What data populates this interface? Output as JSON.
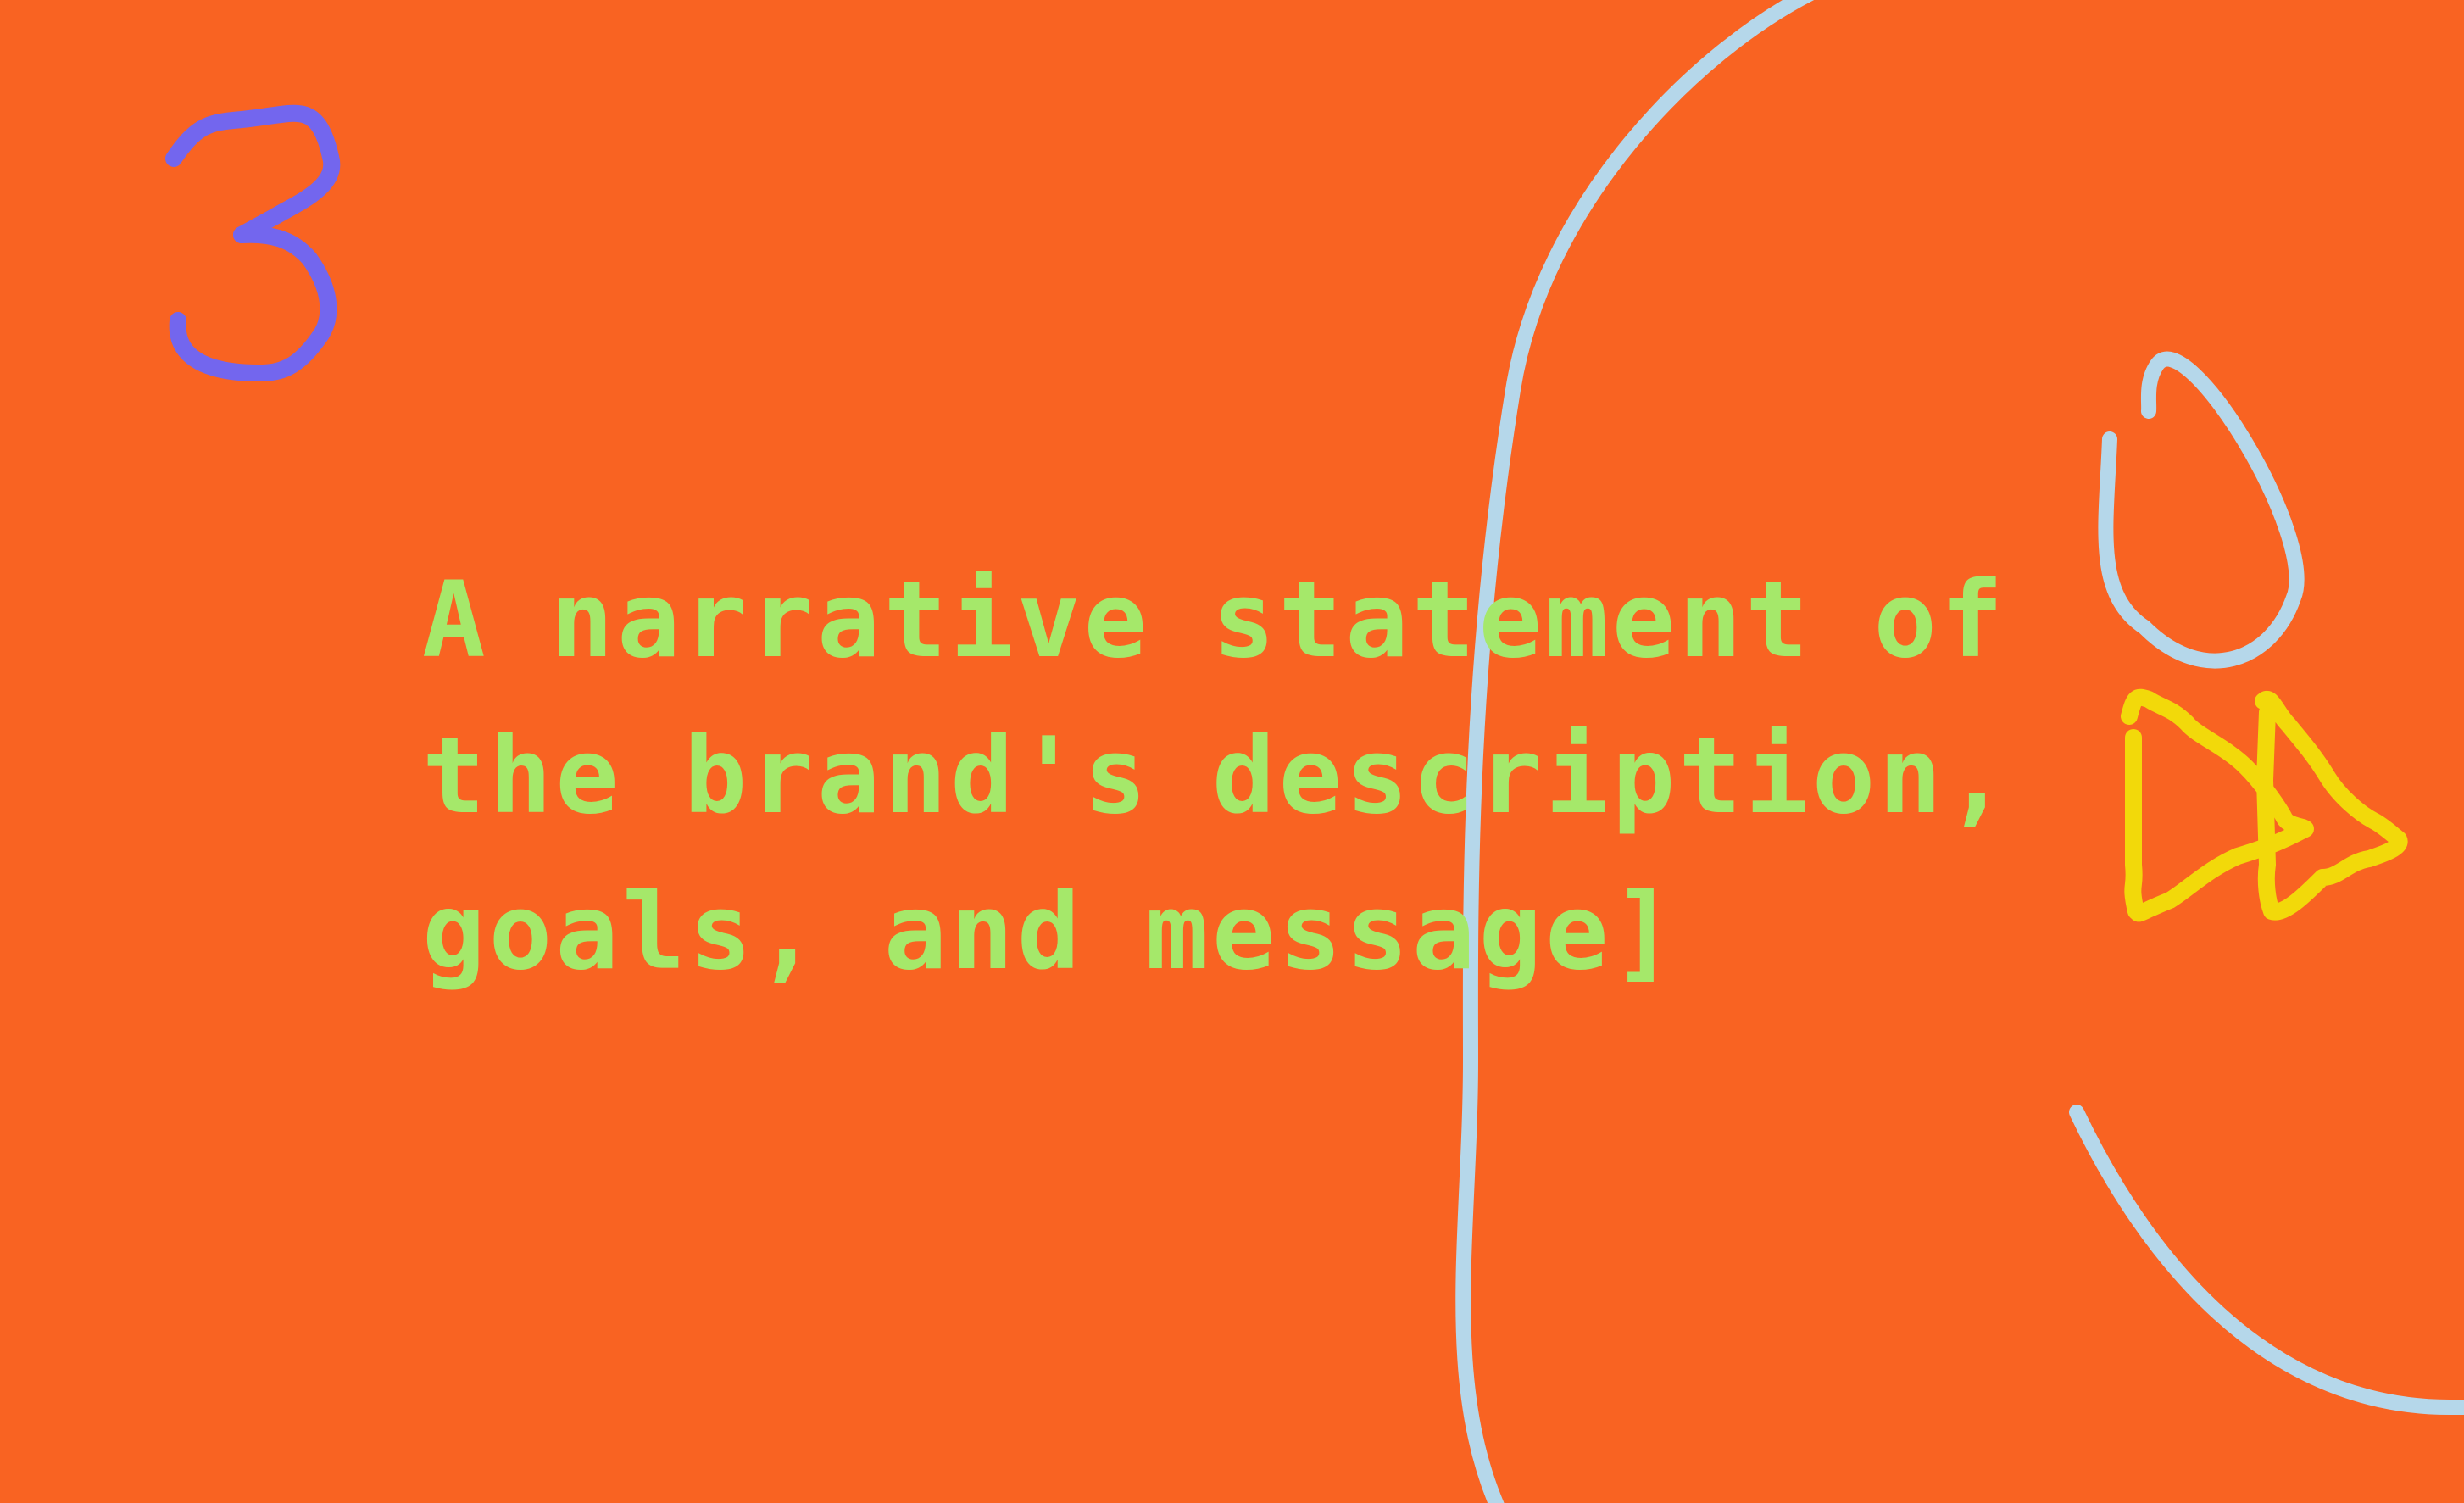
{
  "slide": {
    "number_glyph": "3",
    "statement": "A narrative statement of the brand's description, goals, and message]"
  },
  "colors": {
    "background": "#F96322",
    "text": "#A5E86A",
    "number": "#7366EE",
    "line": "#B5D7EA",
    "arrows": "#F2D90A"
  },
  "decorations": {
    "number_glyph_icon": "handwritten-number-three",
    "curve_icon": "large-hand-drawn-curve",
    "loop_icon": "hand-drawn-loop",
    "arrows_icon": "fast-forward-icon",
    "arc_icon": "hand-drawn-arc"
  }
}
